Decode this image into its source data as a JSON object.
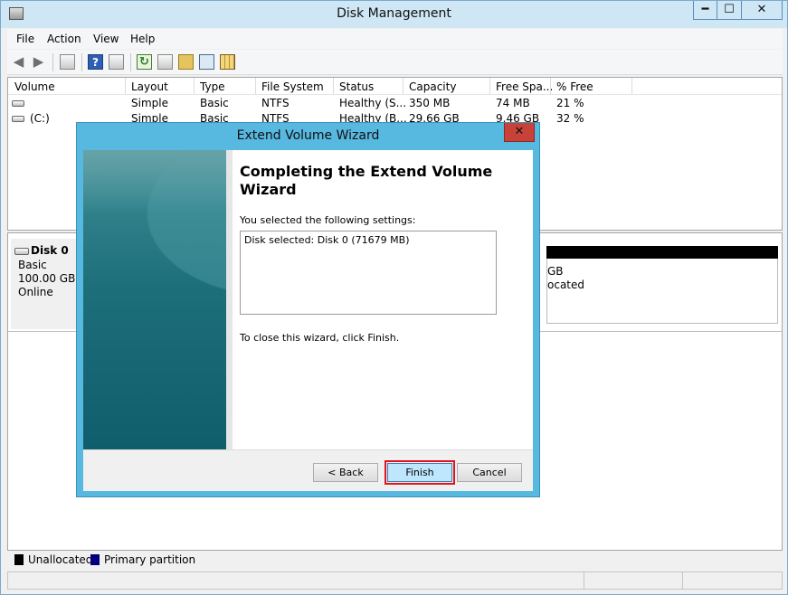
{
  "window": {
    "title": "Disk Management",
    "controls": {
      "minimize": "━",
      "maximize": "☐",
      "close": "✕"
    }
  },
  "menu": [
    "File",
    "Action",
    "View",
    "Help"
  ],
  "toolbar": {
    "icons": [
      "back-icon",
      "forward-icon",
      "console-tree-icon",
      "help-icon",
      "properties-icon",
      "refresh-icon",
      "settings-icon",
      "open-folder-icon",
      "magnifier-icon",
      "grid-icon"
    ]
  },
  "volumes": {
    "columns": [
      "Volume",
      "Layout",
      "Type",
      "File System",
      "Status",
      "Capacity",
      "Free Spa...",
      "% Free"
    ],
    "rows": [
      {
        "volume": "",
        "layout": "Simple",
        "type": "Basic",
        "fs": "NTFS",
        "status": "Healthy (S...",
        "capacity": "350 MB",
        "free": "74 MB",
        "pct": "21 %"
      },
      {
        "volume": "(C:)",
        "layout": "Simple",
        "type": "Basic",
        "fs": "NTFS",
        "status": "Healthy (B...",
        "capacity": "29.66 GB",
        "free": "9.46 GB",
        "pct": "32 %"
      }
    ]
  },
  "disk": {
    "name": "Disk 0",
    "type": "Basic",
    "size": "100.00 GB",
    "state": "Online",
    "partition_size_fragment": "GB",
    "partition_status_fragment": "ocated"
  },
  "legend": {
    "unallocated": "Unallocated",
    "primary": "Primary partition",
    "colors": {
      "unallocated": "#000000",
      "primary": "#00007b"
    }
  },
  "wizard": {
    "title": "Extend Volume Wizard",
    "close_glyph": "✕",
    "heading": "Completing the Extend Volume Wizard",
    "intro": "You selected the following settings:",
    "settings": "Disk selected: Disk 0 (71679 MB)",
    "outro": "To close this wizard, click Finish.",
    "back": "< Back",
    "finish": "Finish",
    "cancel": "Cancel",
    "highlight_color": "#e3121c"
  }
}
